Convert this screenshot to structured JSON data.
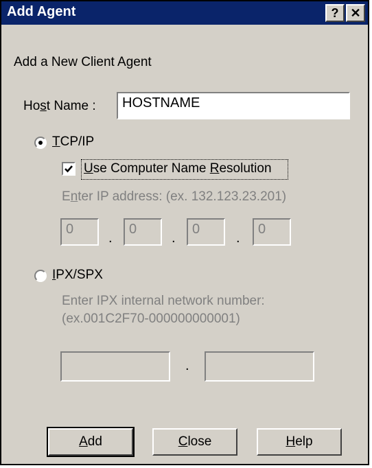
{
  "window": {
    "title": "Add Agent",
    "help_glyph": "?",
    "close_glyph": "✕"
  },
  "header": {
    "text": "Add a New Client Agent"
  },
  "host": {
    "label": "Host Name :",
    "value": "HOSTNAME"
  },
  "tcpip": {
    "label": "TCP/IP",
    "selected": true,
    "use_name_resolution": {
      "label": "Use Computer Name Resolution",
      "checked": true
    },
    "ip_hint": "Enter IP address: (ex. 132.123.23.201)",
    "octets": [
      "0",
      "0",
      "0",
      "0"
    ],
    "separator": "."
  },
  "ipxspx": {
    "label": "IPX/SPX",
    "selected": false,
    "hint_line1": "Enter IPX internal network number:",
    "hint_line2": "(ex.001C2F70-000000000001)",
    "network": "",
    "node": "",
    "separator": "."
  },
  "buttons": {
    "add": "Add",
    "close": "Close",
    "help": "Help"
  }
}
